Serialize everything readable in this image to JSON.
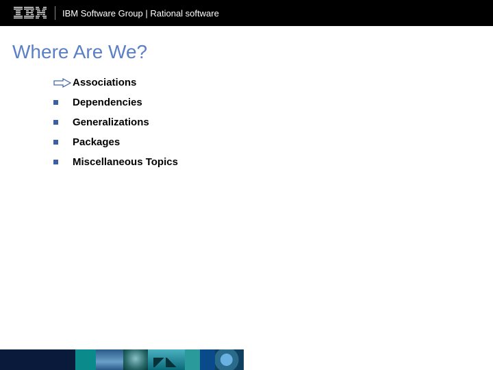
{
  "header": {
    "text": "IBM Software Group | Rational software"
  },
  "title": "Where Are We?",
  "items": [
    {
      "label": "Associations",
      "current": true
    },
    {
      "label": "Dependencies",
      "current": false
    },
    {
      "label": "Generalizations",
      "current": false
    },
    {
      "label": "Packages",
      "current": false
    },
    {
      "label": "Miscellaneous Topics",
      "current": false
    }
  ]
}
